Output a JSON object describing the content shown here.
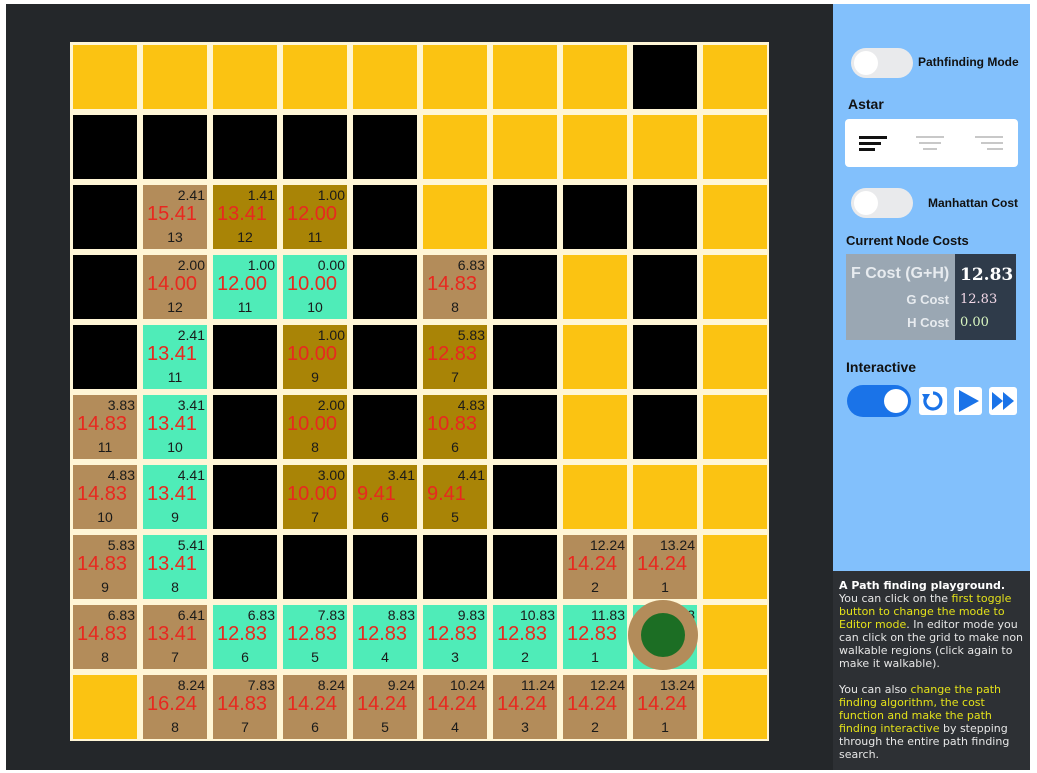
{
  "colors": {
    "walkable": "#fbc312",
    "wall": "#000000",
    "open": "#b38c5a",
    "closed": "#a98406",
    "path": "#4fecb8",
    "agent_ring": "#b38c5a",
    "agent_core": "#1c6e24"
  },
  "grid": {
    "rows": [
      [
        {
          "t": "y"
        },
        {
          "t": "y"
        },
        {
          "t": "y"
        },
        {
          "t": "y"
        },
        {
          "t": "y"
        },
        {
          "t": "y"
        },
        {
          "t": "y"
        },
        {
          "t": "y"
        },
        {
          "t": "b"
        },
        {
          "t": "y"
        }
      ],
      [
        {
          "t": "b"
        },
        {
          "t": "b"
        },
        {
          "t": "b"
        },
        {
          "t": "b"
        },
        {
          "t": "b"
        },
        {
          "t": "y"
        },
        {
          "t": "y"
        },
        {
          "t": "y"
        },
        {
          "t": "y"
        },
        {
          "t": "y"
        }
      ],
      [
        {
          "t": "b"
        },
        {
          "t": "o",
          "g": "2.41",
          "f": "15.41",
          "h": "13"
        },
        {
          "t": "c",
          "g": "1.41",
          "f": "13.41",
          "h": "12"
        },
        {
          "t": "c",
          "g": "1.00",
          "f": "12.00",
          "h": "11"
        },
        {
          "t": "b"
        },
        {
          "t": "y"
        },
        {
          "t": "b"
        },
        {
          "t": "b"
        },
        {
          "t": "b"
        },
        {
          "t": "y"
        }
      ],
      [
        {
          "t": "b"
        },
        {
          "t": "o",
          "g": "2.00",
          "f": "14.00",
          "h": "12"
        },
        {
          "t": "p",
          "g": "1.00",
          "f": "12.00",
          "h": "11"
        },
        {
          "t": "p",
          "g": "0.00",
          "f": "10.00",
          "h": "10"
        },
        {
          "t": "b"
        },
        {
          "t": "o",
          "g": "6.83",
          "f": "14.83",
          "h": "8"
        },
        {
          "t": "b"
        },
        {
          "t": "y"
        },
        {
          "t": "b"
        },
        {
          "t": "y"
        }
      ],
      [
        {
          "t": "b"
        },
        {
          "t": "p",
          "g": "2.41",
          "f": "13.41",
          "h": "11"
        },
        {
          "t": "b"
        },
        {
          "t": "c",
          "g": "1.00",
          "f": "10.00",
          "h": "9"
        },
        {
          "t": "b"
        },
        {
          "t": "c",
          "g": "5.83",
          "f": "12.83",
          "h": "7"
        },
        {
          "t": "b"
        },
        {
          "t": "y"
        },
        {
          "t": "b"
        },
        {
          "t": "y"
        }
      ],
      [
        {
          "t": "o",
          "g": "3.83",
          "f": "14.83",
          "h": "11"
        },
        {
          "t": "p",
          "g": "3.41",
          "f": "13.41",
          "h": "10"
        },
        {
          "t": "b"
        },
        {
          "t": "c",
          "g": "2.00",
          "f": "10.00",
          "h": "8"
        },
        {
          "t": "b"
        },
        {
          "t": "c",
          "g": "4.83",
          "f": "10.83",
          "h": "6"
        },
        {
          "t": "b"
        },
        {
          "t": "y"
        },
        {
          "t": "b"
        },
        {
          "t": "y"
        }
      ],
      [
        {
          "t": "o",
          "g": "4.83",
          "f": "14.83",
          "h": "10"
        },
        {
          "t": "p",
          "g": "4.41",
          "f": "13.41",
          "h": "9"
        },
        {
          "t": "b"
        },
        {
          "t": "c",
          "g": "3.00",
          "f": "10.00",
          "h": "7"
        },
        {
          "t": "c",
          "g": "3.41",
          "f": "9.41",
          "h": "6"
        },
        {
          "t": "c",
          "g": "4.41",
          "f": "9.41",
          "h": "5"
        },
        {
          "t": "b"
        },
        {
          "t": "y"
        },
        {
          "t": "y"
        },
        {
          "t": "y"
        }
      ],
      [
        {
          "t": "o",
          "g": "5.83",
          "f": "14.83",
          "h": "9"
        },
        {
          "t": "p",
          "g": "5.41",
          "f": "13.41",
          "h": "8"
        },
        {
          "t": "b"
        },
        {
          "t": "b"
        },
        {
          "t": "b"
        },
        {
          "t": "b"
        },
        {
          "t": "b"
        },
        {
          "t": "o",
          "g": "12.24",
          "f": "14.24",
          "h": "2"
        },
        {
          "t": "o",
          "g": "13.24",
          "f": "14.24",
          "h": "1"
        },
        {
          "t": "y"
        }
      ],
      [
        {
          "t": "o",
          "g": "6.83",
          "f": "14.83",
          "h": "8"
        },
        {
          "t": "o",
          "g": "6.41",
          "f": "13.41",
          "h": "7"
        },
        {
          "t": "p",
          "g": "6.83",
          "f": "12.83",
          "h": "6"
        },
        {
          "t": "p",
          "g": "7.83",
          "f": "12.83",
          "h": "5"
        },
        {
          "t": "p",
          "g": "8.83",
          "f": "12.83",
          "h": "4"
        },
        {
          "t": "p",
          "g": "9.83",
          "f": "12.83",
          "h": "3"
        },
        {
          "t": "p",
          "g": "10.83",
          "f": "12.83",
          "h": "2"
        },
        {
          "t": "p",
          "g": "11.83",
          "f": "12.83",
          "h": "1"
        },
        {
          "t": "p",
          "g": "12.83",
          "f": "",
          "h": ""
        },
        {
          "t": "y"
        }
      ],
      [
        {
          "t": "y"
        },
        {
          "t": "o",
          "g": "8.24",
          "f": "16.24",
          "h": "8"
        },
        {
          "t": "o",
          "g": "7.83",
          "f": "14.83",
          "h": "7"
        },
        {
          "t": "o",
          "g": "8.24",
          "f": "14.24",
          "h": "6"
        },
        {
          "t": "o",
          "g": "9.24",
          "f": "14.24",
          "h": "5"
        },
        {
          "t": "o",
          "g": "10.24",
          "f": "14.24",
          "h": "4"
        },
        {
          "t": "o",
          "g": "11.24",
          "f": "14.24",
          "h": "3"
        },
        {
          "t": "o",
          "g": "12.24",
          "f": "14.24",
          "h": "2"
        },
        {
          "t": "o",
          "g": "13.24",
          "f": "14.24",
          "h": "1"
        },
        {
          "t": "y"
        }
      ]
    ]
  },
  "panel": {
    "pathfinding_mode_label": "Pathfinding Mode",
    "algorithm_label": "Astar",
    "manhattan_label": "Manhattan Cost",
    "current_costs_label": "Current Node Costs",
    "f_cost_label": "F Cost (G+H)",
    "g_cost_label": "G Cost",
    "h_cost_label": "H Cost",
    "f_cost_value": "12.83",
    "g_cost_value": "12.83",
    "h_cost_value": "0.00",
    "interactive_label": "Interactive",
    "icons": [
      "align-left-icon",
      "align-center-icon",
      "align-right-icon",
      "reset-icon",
      "play-icon",
      "fast-forward-icon"
    ]
  },
  "info": {
    "title": "A Path finding playground.",
    "p1_a": "You can click on the ",
    "p1_hl": "first toggle button to change  the mode to Editor mode",
    "p1_b": ". In editor mode you can click on the grid to make non walkable regions (click again to make it walkable).",
    "p2_a": "You can also ",
    "p2_hl": "change the path finding algorithm, the cost function and make the path finding interactive",
    "p2_b": " by stepping through the entire path finding search."
  }
}
